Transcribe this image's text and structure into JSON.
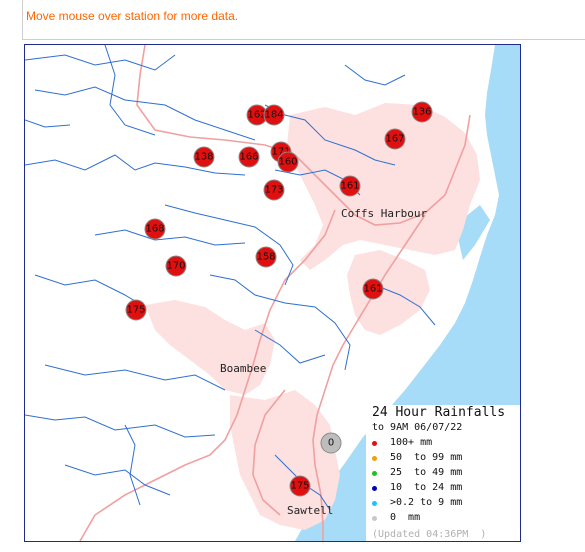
{
  "notice": "Move mouse over station for more data.",
  "map": {
    "towns": [
      "Coffs Harbour",
      "Boambee",
      "Sawtell"
    ],
    "colors": {
      "sea": "#a6dcf7",
      "urban": "#fde0e0",
      "road": "#f0a0a0",
      "river": "#2f6fd0",
      "frame": "#1f2b8c"
    },
    "stations": [
      "162",
      "184",
      "136",
      "167",
      "138",
      "166",
      "171",
      "160",
      "173",
      "161",
      "168",
      "158",
      "170",
      "161",
      "175",
      "0",
      "175"
    ]
  },
  "legend": {
    "title": "24 Hour Rainfalls",
    "subtitle": "to 9AM 06/07/22",
    "rows": [
      {
        "label": "100+ mm",
        "color": "#e01010"
      },
      {
        "label": "50  to 99 mm",
        "color": "#f0a000"
      },
      {
        "label": "25  to 49 mm",
        "color": "#20c020"
      },
      {
        "label": "10  to 24 mm",
        "color": "#0000c0"
      },
      {
        "label": ">0.2 to 9 mm",
        "color": "#20c0ff"
      },
      {
        "label": "0  mm",
        "color": "#c8c8c8"
      }
    ],
    "updated": "(Updated 04:36PM  )"
  }
}
